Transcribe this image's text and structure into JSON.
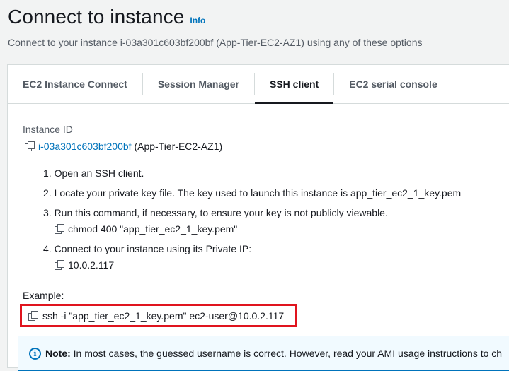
{
  "header": {
    "title": "Connect to instance",
    "info_label": "Info",
    "subtitle": "Connect to your instance i-03a301c603bf200bf (App-Tier-EC2-AZ1) using any of these options"
  },
  "tabs": [
    {
      "label": "EC2 Instance Connect",
      "active": false
    },
    {
      "label": "Session Manager",
      "active": false
    },
    {
      "label": "SSH client",
      "active": true
    },
    {
      "label": "EC2 serial console",
      "active": false
    }
  ],
  "instance": {
    "label": "Instance ID",
    "id": "i-03a301c603bf200bf",
    "name": "(App-Tier-EC2-AZ1)"
  },
  "steps": [
    "1. Open an SSH client.",
    "2. Locate your private key file. The key used to launch this instance is app_tier_ec2_1_key.pem",
    "3. Run this command, if necessary, to ensure your key is not publicly viewable.",
    "4. Connect to your instance using its Private IP:"
  ],
  "commands": {
    "chmod": "chmod 400 \"app_tier_ec2_1_key.pem\"",
    "private_ip": "10.0.2.117"
  },
  "example": {
    "label": "Example:",
    "command": "ssh -i \"app_tier_ec2_1_key.pem\" ec2-user@10.0.2.117"
  },
  "note": {
    "prefix": "Note:",
    "text": "In most cases, the guessed username is correct. However, read your AMI usage instructions to ch"
  },
  "colors": {
    "link": "#0073bb",
    "highlight_border": "#e0141e",
    "note_background": "#f1faff"
  }
}
